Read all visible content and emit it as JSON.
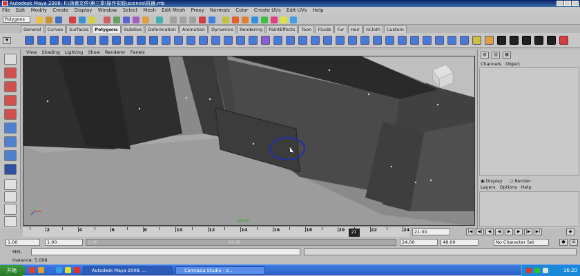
{
  "window": {
    "title": "Autodesk Maya 2008: F:\\场景文件\\第三章\\操作实践\\scenes\\机器.mb"
  },
  "menu": [
    "File",
    "Edit",
    "Modify",
    "Create",
    "Display",
    "Window",
    "Select",
    "Mesh",
    "Edit Mesh",
    "Proxy",
    "Normals",
    "Color",
    "Create UVs",
    "Edit UVs",
    "Help"
  ],
  "status_row": {
    "mode_value": "Polygons"
  },
  "shelf_tabs": [
    {
      "label": "General"
    },
    {
      "label": "Curves"
    },
    {
      "label": "Surfaces"
    },
    {
      "label": "Polygons",
      "active": true
    },
    {
      "label": "Subdivs"
    },
    {
      "label": "Deformation"
    },
    {
      "label": "Animation"
    },
    {
      "label": "Dynamics"
    },
    {
      "label": "Rendering"
    },
    {
      "label": "PaintEffects"
    },
    {
      "label": "Toon"
    },
    {
      "label": "Fluids"
    },
    {
      "label": "Fur"
    },
    {
      "label": "Hair"
    },
    {
      "label": "nCloth"
    },
    {
      "label": "Custom"
    }
  ],
  "viewport": {
    "menu": [
      "View",
      "Shading",
      "Lighting",
      "Show",
      "Renderer",
      "Panels"
    ],
    "camera_label": "persp"
  },
  "channel_box": {
    "header": [
      "Channels",
      "Object"
    ]
  },
  "layer_editor": {
    "radio_display": "Display",
    "radio_render": "Render",
    "menu": [
      "Layers",
      "Options",
      "Help"
    ]
  },
  "timeline": {
    "ticks": [
      2,
      4,
      6,
      8,
      10,
      12,
      14,
      16,
      18,
      20,
      22,
      24
    ],
    "range_start": 1,
    "range_end": 24,
    "current_frame": "21",
    "current_time_field": "21.00"
  },
  "range_slider": {
    "start_time": "1.00",
    "playback_start": "1.00",
    "inner_start": "1.00",
    "inner_end": "24.00",
    "playback_end": "24.00",
    "end_time": "48.00",
    "character_set": "No Character Set"
  },
  "command_line": {
    "label": "MEL"
  },
  "help_line": {
    "text": "Instance: 5.098"
  },
  "taskbar": {
    "start_label": "开始",
    "tasks": [
      "Autodesk Maya 2008: ...",
      "Camtasia Studio - V..."
    ],
    "clock": "16:20"
  },
  "colors": {
    "accent_blue": "#0a246a",
    "viewport_bg": "#8a8a8a",
    "manipulator": "#1e2fb0",
    "vertex": "#aef0ff"
  }
}
